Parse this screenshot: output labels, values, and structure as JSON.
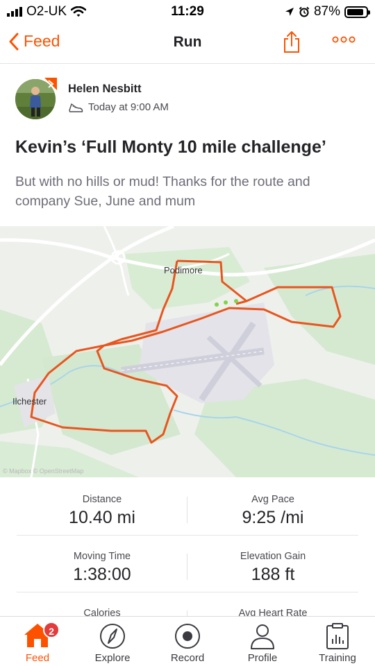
{
  "status_bar": {
    "carrier": "O2-UK",
    "time": "11:29",
    "battery": "87%",
    "battery_level": 0.87
  },
  "nav": {
    "back_label": "Feed",
    "title": "Run"
  },
  "athlete": {
    "name": "Helen Nesbitt",
    "time": "Today at 9:00 AM"
  },
  "activity": {
    "title": "Kevin’s ‘Full Monty 10 mile challenge’",
    "description": "But with no hills or mud! Thanks for the route and company Sue, June and mum"
  },
  "map": {
    "places": [
      "Podimore",
      "Ilchester"
    ],
    "attribution": "© Mapbox © OpenStreetMap",
    "route_color": "#e8551e"
  },
  "stats": [
    {
      "left": {
        "label": "Distance",
        "value": "10.40 mi"
      },
      "right": {
        "label": "Avg Pace",
        "value": "9:25 /mi"
      }
    },
    {
      "left": {
        "label": "Moving Time",
        "value": "1:38:00"
      },
      "right": {
        "label": "Elevation Gain",
        "value": "188 ft"
      }
    },
    {
      "left": {
        "label": "Calories",
        "value": ""
      },
      "right": {
        "label": "Avg Heart Rate",
        "value": ""
      }
    }
  ],
  "tabs": [
    {
      "label": "Feed",
      "icon": "home-icon",
      "badge": "2"
    },
    {
      "label": "Explore",
      "icon": "compass-icon"
    },
    {
      "label": "Record",
      "icon": "record-icon"
    },
    {
      "label": "Profile",
      "icon": "profile-icon"
    },
    {
      "label": "Training",
      "icon": "training-icon"
    }
  ],
  "colors": {
    "accent": "#fc5200",
    "text": "#242428",
    "muted": "#6d6d78",
    "badge": "#e33b3b"
  }
}
